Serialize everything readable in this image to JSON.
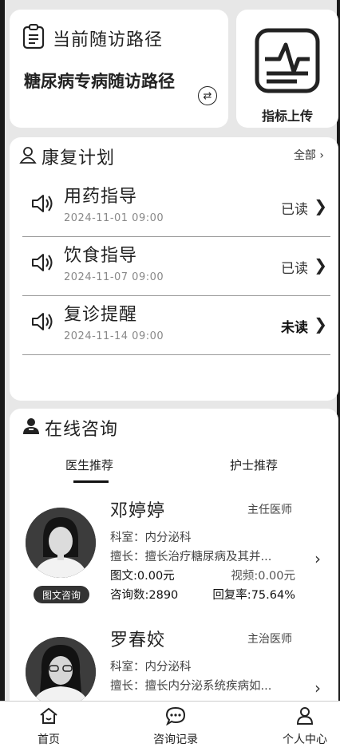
{
  "path_card": {
    "title": "当前随访路径",
    "path_name": "糖尿病专病随访路径",
    "switch_symbol": "⇄"
  },
  "upload_card": {
    "label": "指标上传"
  },
  "rehab": {
    "title": "康复计划",
    "all_label": "全部 ›",
    "items": [
      {
        "name": "用药指导",
        "date": "2024-11-01  09:00",
        "status": "已读"
      },
      {
        "name": "饮食指导",
        "date": "2024-11-07  09:00",
        "status": "已读"
      },
      {
        "name": "复诊提醒",
        "date": "2024-11-14  09:00",
        "status": "未读"
      }
    ]
  },
  "consult": {
    "title": "在线咨询",
    "tabs": [
      "医生推荐",
      "护士推荐"
    ],
    "doctors": [
      {
        "name": "邓婷婷",
        "rank": "主任医师",
        "dept": "科室：内分泌科",
        "specialty": "擅长：擅长治疗糖尿病及其并...",
        "text_price": "图文:0.00元",
        "video_price": "视频:0.00元",
        "consult_count": "咨询数:2890",
        "reply_rate": "回复率:75.64%",
        "button": "图文咨询"
      },
      {
        "name": "罗春姣",
        "rank": "主治医师",
        "dept": "科室：内分泌科",
        "specialty": "擅长：擅长内分泌系统疾病如..."
      }
    ]
  },
  "tabbar": [
    {
      "label": "首页",
      "icon": "home-icon"
    },
    {
      "label": "咨询记录",
      "icon": "chat-icon"
    },
    {
      "label": "个人中心",
      "icon": "user-icon"
    }
  ]
}
